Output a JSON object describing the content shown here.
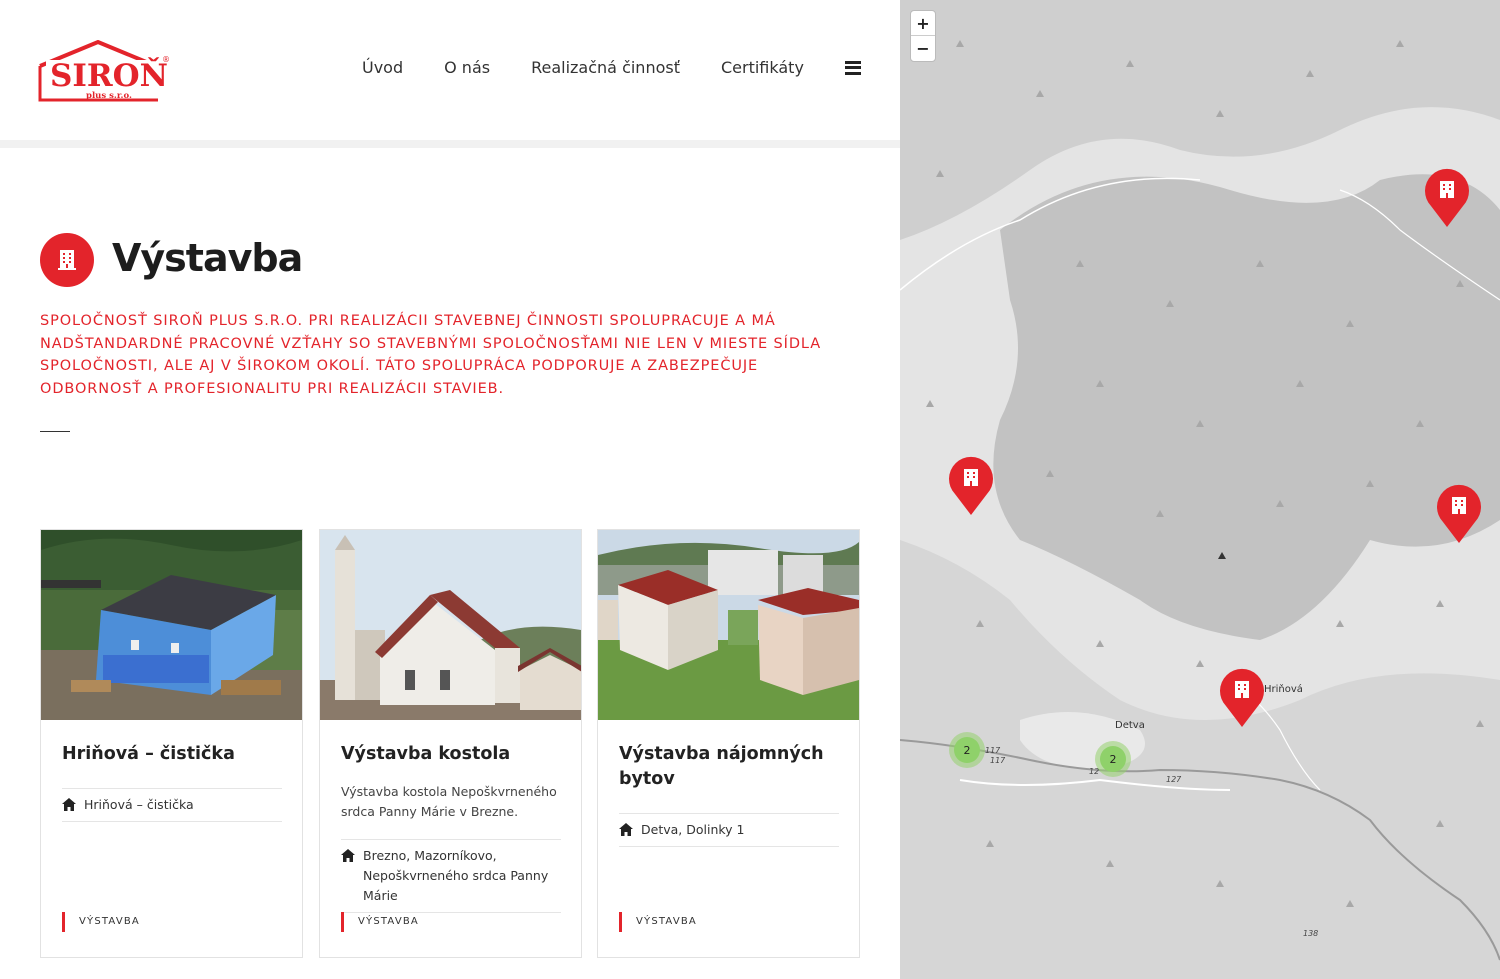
{
  "brand": {
    "logo_text": "SIROŇ",
    "logo_sub": "plus s.r.o.",
    "logo_reg": "®",
    "accent_color": "#e3242b"
  },
  "nav": {
    "items": [
      "Úvod",
      "O nás",
      "Realizačná činnosť",
      "Certifikáty"
    ],
    "menu_icon": "hamburger-icon"
  },
  "page": {
    "title": "Výstavba",
    "title_icon": "building-icon",
    "intro": "SPOLOČNOSŤ SIROŇ PLUS S.R.O. PRI REALIZÁCII STAVEBNEJ ČINNOSTI SPOLUPRACUJE A MÁ NADŠTANDARDNÉ PRACOVNÉ VZŤAHY SO STAVEBNÝMI SPOLOČNOSŤAMI NIE LEN V MIESTE SÍDLA SPOLOČNOSTI, ALE AJ V ŠIROKOM OKOLÍ. TÁTO SPOLUPRÁCA PODPORUJE A ZABEZPEČUJE ODBORNOSŤ A PROFESIONALITU PRI REALIZÁCII STAVIEB."
  },
  "cards": [
    {
      "title": "Hriňová – čistička",
      "description": "",
      "location": "Hriňová – čistička",
      "category": "VÝSTAVBA"
    },
    {
      "title": "Výstavba kostola",
      "description": "Výstavba kostola Nepoškvrneného srdca Panny Márie v Brezne.",
      "location": "Brezno, Mazorníkovo, Nepoškvrneného srdca Panny Márie",
      "category": "VÝSTAVBA"
    },
    {
      "title": "Výstavba nájomných bytov",
      "description": "",
      "location": "Detva, Dolinky 1",
      "category": "VÝSTAVBA"
    }
  ],
  "map": {
    "zoom_in": "+",
    "zoom_out": "−",
    "places": [
      "Detva",
      "Hriňová"
    ],
    "roads": [
      "117",
      "117",
      "127",
      "12",
      "138"
    ],
    "clusters": [
      "2",
      "2"
    ],
    "marker_icon": "building-icon",
    "cluster_color": "#8fd16a"
  }
}
